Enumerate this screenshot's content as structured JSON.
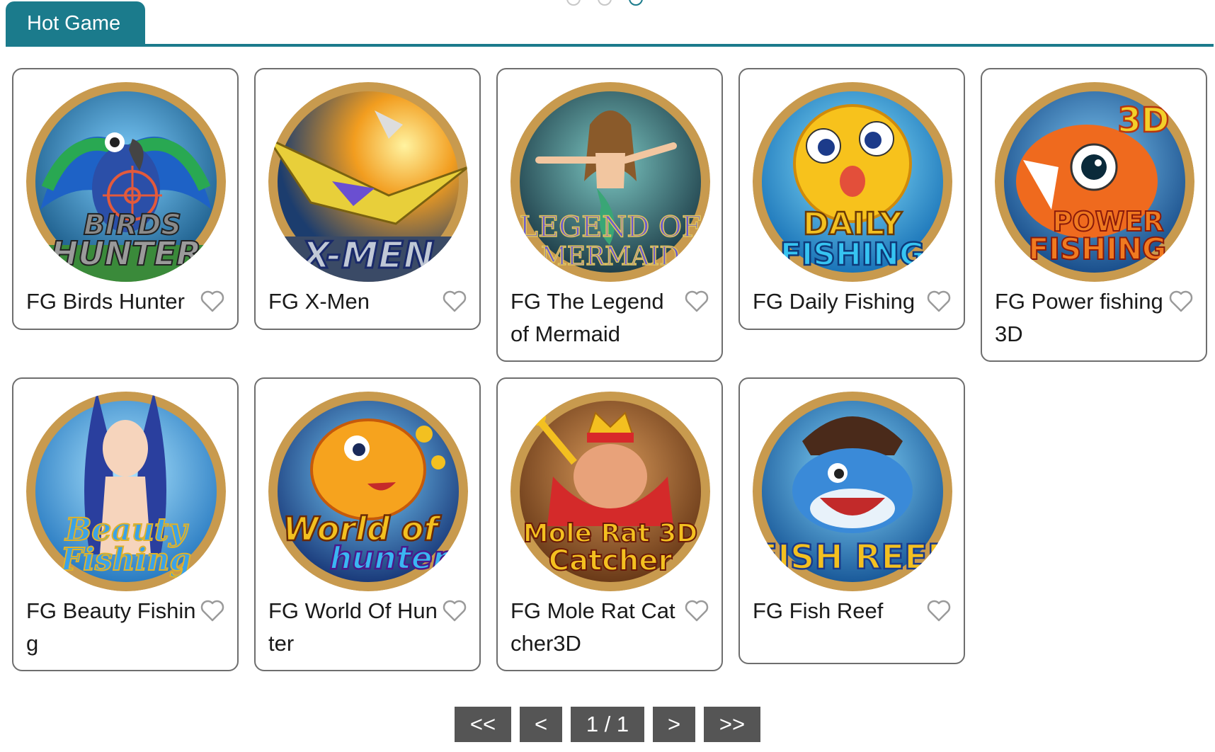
{
  "header": {
    "tab_label": "Hot Game"
  },
  "colors": {
    "accent": "#1b7b8c",
    "pager_bg": "#555555",
    "card_border": "#6e6e6e"
  },
  "games": [
    {
      "title": "FG Birds Hunter",
      "art_text_1": "BIRDS",
      "art_text_2": "HUNTER",
      "icon": "heart-outline-icon"
    },
    {
      "title": "FG X-Men",
      "art_text_1": "X-MEN",
      "art_text_2": "",
      "icon": "heart-outline-icon"
    },
    {
      "title": "FG The Legend of Mermaid",
      "art_text_1": "LEGEND OF",
      "art_text_2": "MERMAID",
      "icon": "heart-outline-icon"
    },
    {
      "title": "FG Daily Fishing",
      "art_text_1": "DAILY",
      "art_text_2": "FISHING",
      "icon": "heart-outline-icon"
    },
    {
      "title": "FG Power fishing 3D",
      "art_text_1": "POWER",
      "art_text_2": "FISHING",
      "art_text_3": "3D",
      "icon": "heart-outline-icon"
    },
    {
      "title": "FG Beauty Fishing",
      "art_text_1": "Beauty",
      "art_text_2": "Fishing",
      "icon": "heart-outline-icon"
    },
    {
      "title": "FG World Of Hunter",
      "art_text_1": "World of",
      "art_text_2": "hunter",
      "icon": "heart-outline-icon"
    },
    {
      "title": "FG Mole Rat Catcher3D",
      "art_text_1": "Mole Rat 3D",
      "art_text_2": "Catcher",
      "icon": "heart-outline-icon"
    },
    {
      "title": "FG Fish Reef",
      "art_text_1": "FISH REEF",
      "art_text_2": "",
      "icon": "heart-outline-icon"
    }
  ],
  "pagination": {
    "first": "<<",
    "prev": "<",
    "page_indicator": "1 / 1",
    "next": ">",
    "last": ">>"
  }
}
